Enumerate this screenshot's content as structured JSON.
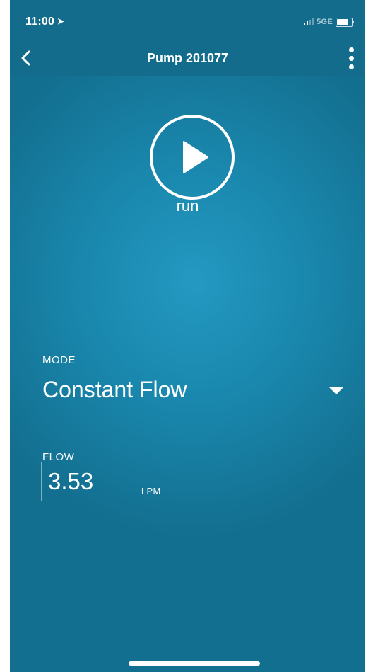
{
  "status_bar": {
    "time": "11:00",
    "location_icon": "location-arrow-icon",
    "network": "5GE",
    "signal_bars_filled": 2,
    "signal_bars_total": 4,
    "battery_level": 0.8
  },
  "nav": {
    "title": "Pump 201077",
    "back_icon": "chevron-left-icon",
    "menu_icon": "vertical-ellipsis-icon"
  },
  "run": {
    "label": "run",
    "icon": "play-circle-icon"
  },
  "mode": {
    "label": "MODE",
    "value": "Constant Flow",
    "dropdown_icon": "caret-down-icon"
  },
  "flow": {
    "label": "FLOW",
    "value": "3.53",
    "unit": "LPM"
  },
  "colors": {
    "background": "#1a88ae",
    "header": "#136c8c",
    "foreground": "#ffffff"
  }
}
